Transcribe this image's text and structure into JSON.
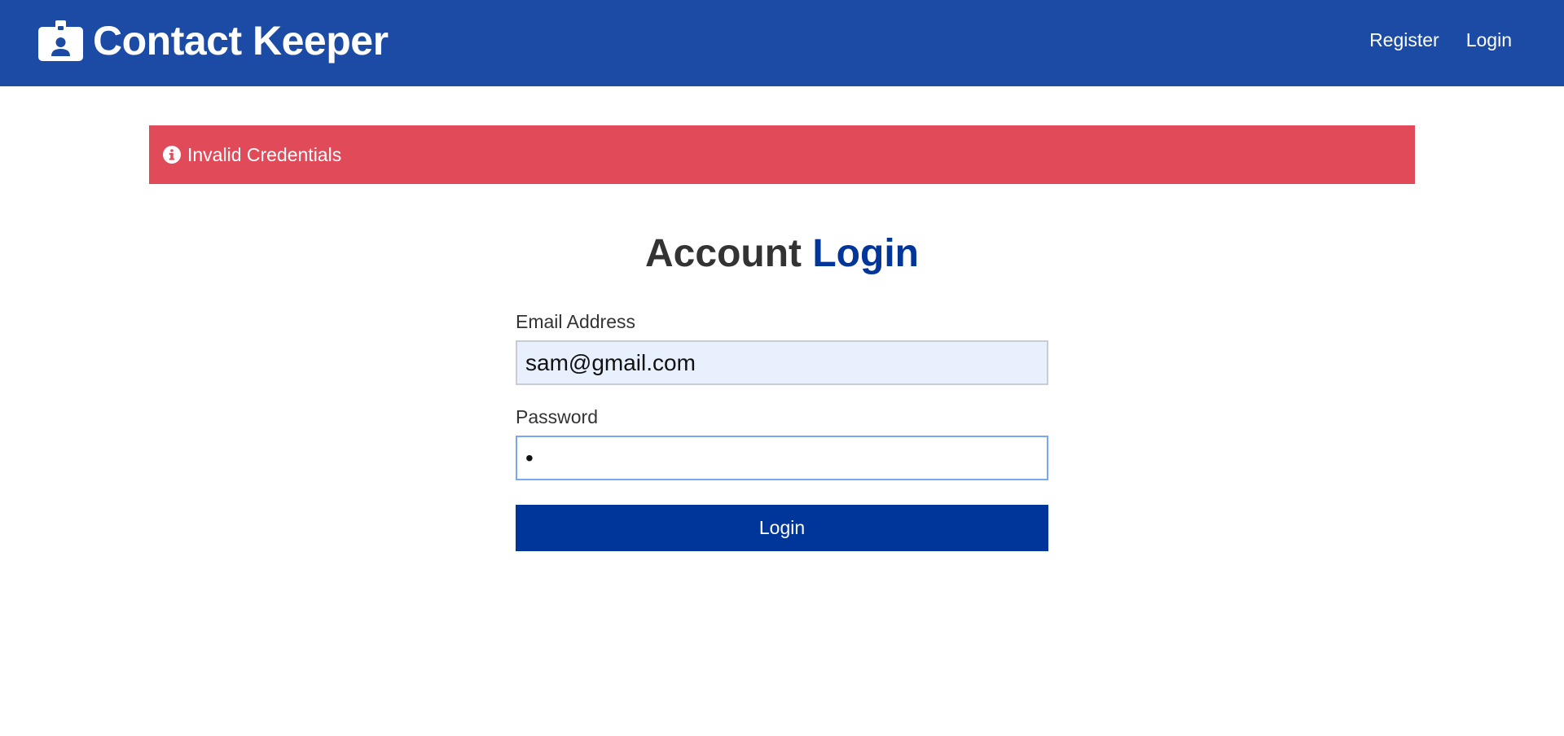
{
  "app": {
    "title": "Contact Keeper",
    "logo_icon": "id-badge-icon"
  },
  "nav": {
    "links": [
      {
        "label": "Register"
      },
      {
        "label": "Login"
      }
    ]
  },
  "alert": {
    "icon": "info-circle-icon",
    "message": "Invalid Credentials",
    "type": "danger"
  },
  "heading": {
    "prefix": "Account",
    "accent": "Login"
  },
  "form": {
    "email_label": "Email Address",
    "email_value": "sam@gmail.com",
    "password_label": "Password",
    "password_value": "•",
    "submit_label": "Login"
  },
  "colors": {
    "navbar": "#1c4ba5",
    "alert_danger": "#e04a59",
    "primary": "#003699",
    "autofill_bg": "#e8f0fe",
    "focus_border": "#7aa7f5"
  }
}
